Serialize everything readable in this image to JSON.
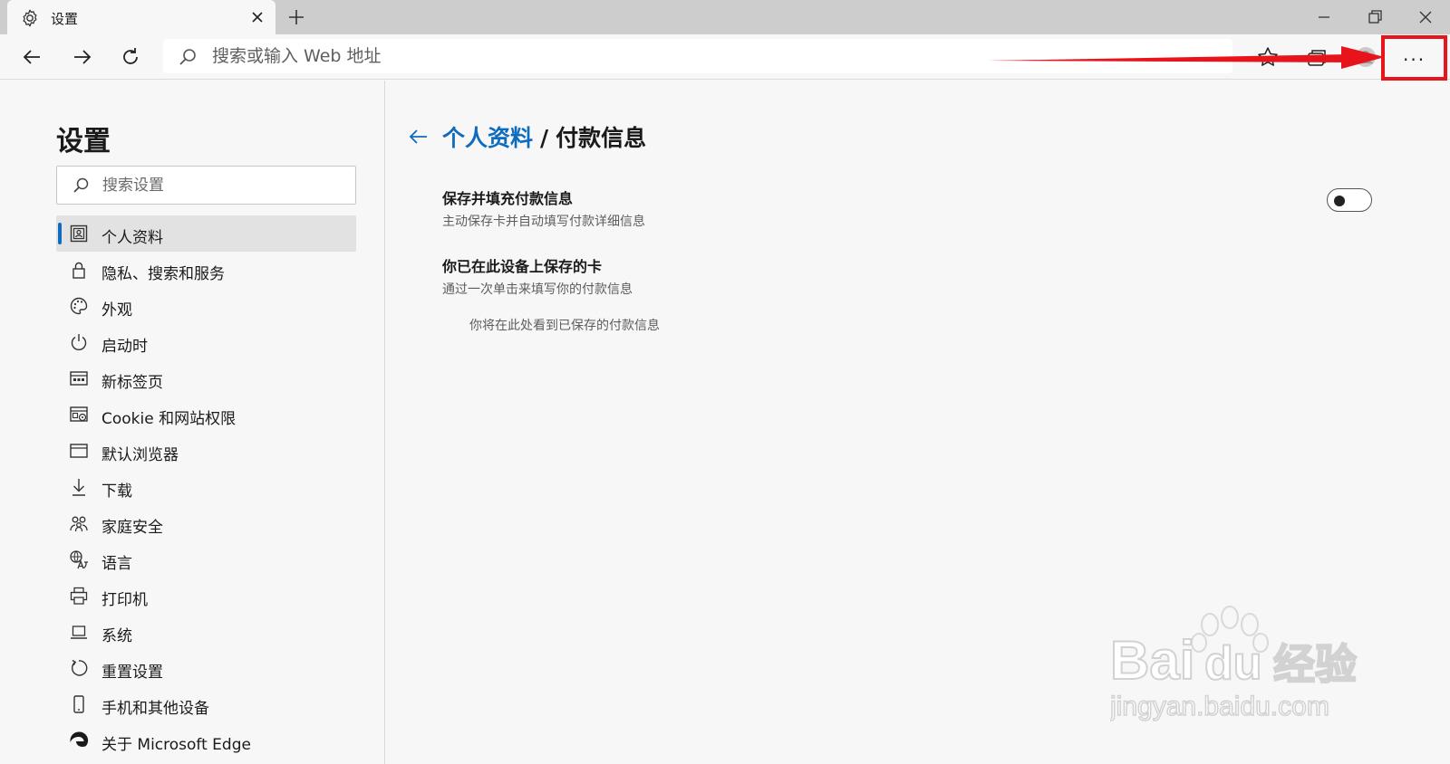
{
  "tab": {
    "title": "设置"
  },
  "toolbar": {
    "address_placeholder": "搜索或输入 Web 地址"
  },
  "sidebar": {
    "title": "设置",
    "search_placeholder": "搜索设置",
    "items": [
      {
        "label": "个人资料",
        "icon": "profile-icon",
        "active": true
      },
      {
        "label": "隐私、搜索和服务",
        "icon": "lock-icon"
      },
      {
        "label": "外观",
        "icon": "palette-icon"
      },
      {
        "label": "启动时",
        "icon": "power-icon"
      },
      {
        "label": "新标签页",
        "icon": "newtab-page-icon"
      },
      {
        "label": "Cookie 和网站权限",
        "icon": "site-permissions-icon"
      },
      {
        "label": "默认浏览器",
        "icon": "browser-window-icon"
      },
      {
        "label": "下载",
        "icon": "download-icon"
      },
      {
        "label": "家庭安全",
        "icon": "family-icon"
      },
      {
        "label": "语言",
        "icon": "language-icon"
      },
      {
        "label": "打印机",
        "icon": "printer-icon"
      },
      {
        "label": "系统",
        "icon": "laptop-icon"
      },
      {
        "label": "重置设置",
        "icon": "reset-icon"
      },
      {
        "label": "手机和其他设备",
        "icon": "phone-icon"
      },
      {
        "label": "关于 Microsoft Edge",
        "icon": "edge-logo-icon"
      }
    ]
  },
  "main": {
    "breadcrumb_parent": "个人资料",
    "breadcrumb_separator": "/",
    "breadcrumb_current": "付款信息",
    "settings": [
      {
        "title": "保存并填充付款信息",
        "desc": "主动保存卡并自动填写付款详细信息",
        "toggle_on": false
      },
      {
        "title": "你已在此设备上保存的卡",
        "desc": "通过一次单击来填写你的付款信息"
      }
    ],
    "empty_message": "你将在此处看到已保存的付款信息"
  },
  "colors": {
    "accent": "#0f6cbd",
    "annotation": "#e8141c"
  },
  "watermark": {
    "brand": "Baidu经验",
    "url": "jingyan.baidu.com"
  }
}
